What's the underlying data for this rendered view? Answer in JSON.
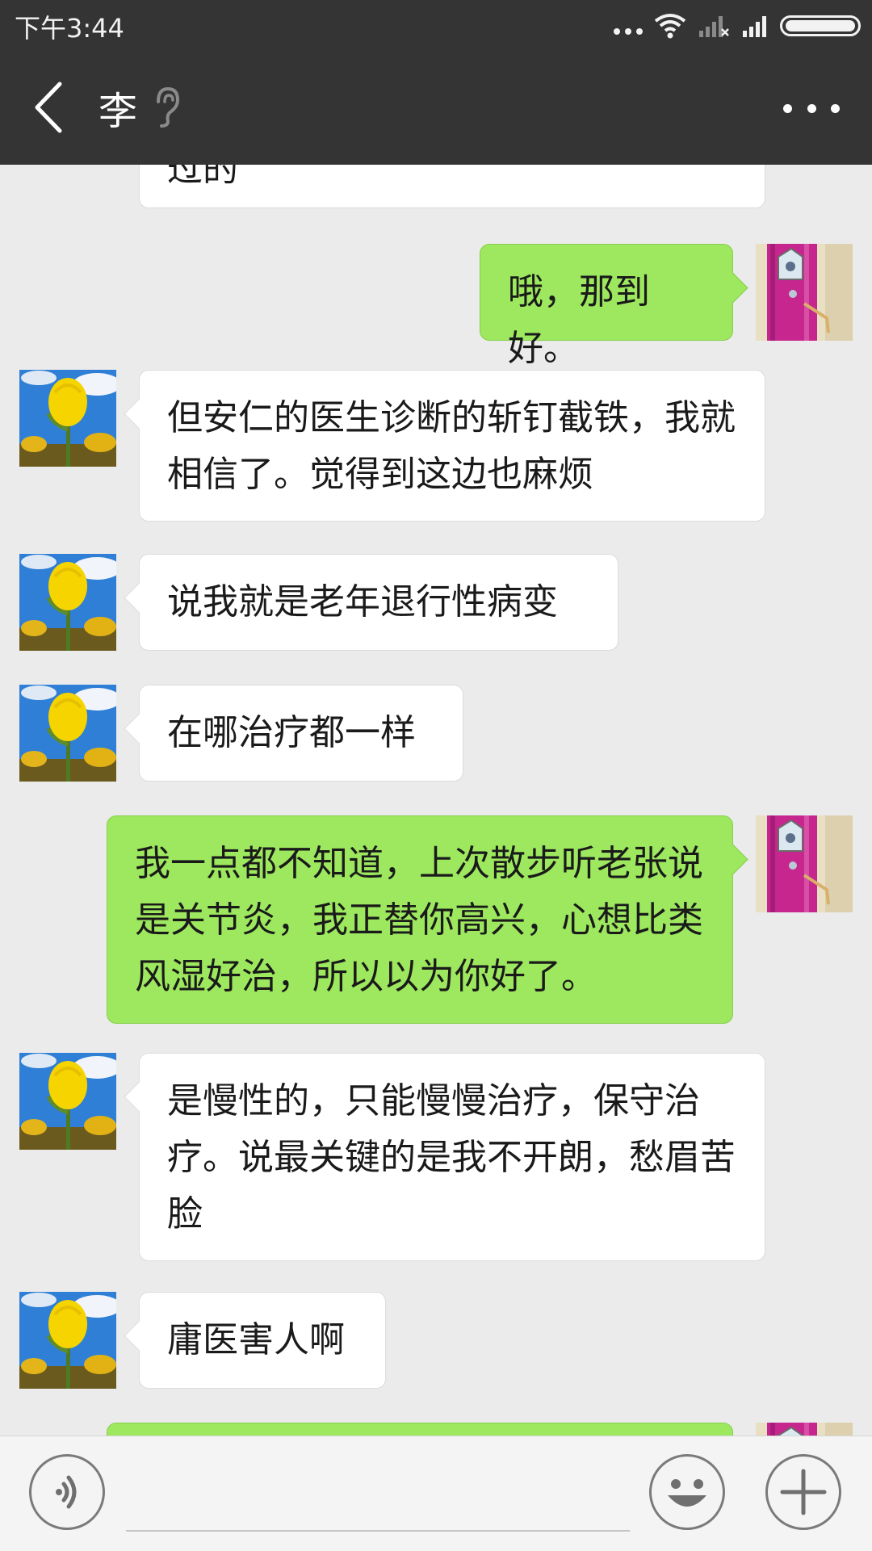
{
  "status_bar": {
    "time": "下午3:44"
  },
  "header": {
    "title": "李",
    "back_icon": "chevron-left-icon",
    "ear_icon": "ear-icon",
    "more_icon": "more-horizontal-icon"
  },
  "messages": [
    {
      "side": "in",
      "text": "过的",
      "partial": true
    },
    {
      "side": "out",
      "text": "哦，那到好。"
    },
    {
      "side": "in",
      "text": "但安仁的医生诊断的斩钉截铁，我就相信了。觉得到这边也麻烦"
    },
    {
      "side": "in",
      "text": "说我就是老年退行性病变"
    },
    {
      "side": "in",
      "text": "在哪治疗都一样"
    },
    {
      "side": "out",
      "text": "我一点都不知道，上次散步听老张说是关节炎，我正替你高兴，心想比类风湿好治，所以以为你好了。"
    },
    {
      "side": "in",
      "text": "是慢性的，只能慢慢治疗，保守治疗。说最关键的是我不开朗，愁眉苦脸"
    },
    {
      "side": "in",
      "text": "庸医害人啊"
    },
    {
      "side": "out",
      "text": "",
      "partial": true
    }
  ],
  "input_bar": {
    "voice_icon": "voice-icon",
    "emoji_icon": "emoji-icon",
    "plus_icon": "plus-icon",
    "input_value": ""
  },
  "colors": {
    "header_bg": "#343434",
    "chat_bg": "#ebebeb",
    "outgoing_bubble": "#9de85f",
    "incoming_bubble": "#ffffff"
  }
}
